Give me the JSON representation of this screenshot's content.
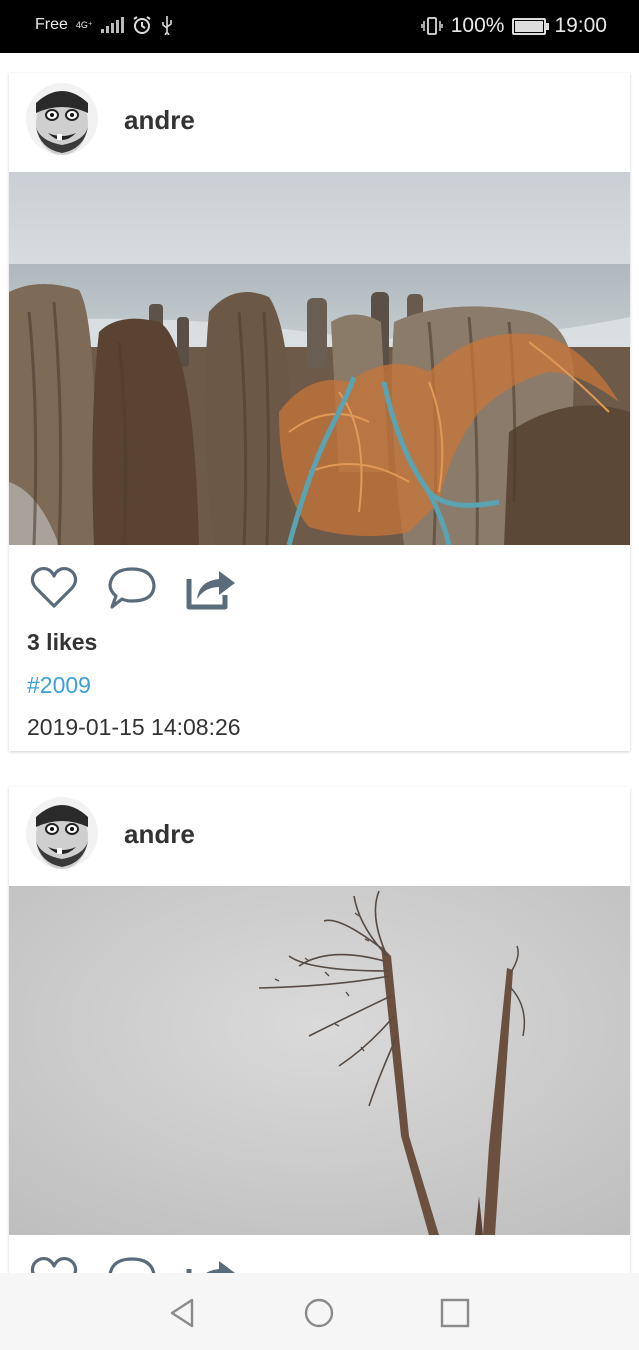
{
  "status_bar": {
    "carrier": "Free",
    "network": "4G⁺",
    "battery": "100%",
    "time": "19:00",
    "icons": [
      "signal-icon",
      "alarm-icon",
      "usb-icon",
      "vibrate-icon",
      "battery-icon"
    ]
  },
  "posts": [
    {
      "username": "andre",
      "likes": "3 likes",
      "tag": "#2009",
      "timestamp": "2019-01-15 14:08:26",
      "photo": "wooden-groyne-posts-with-fishing-net"
    },
    {
      "username": "andre",
      "photo": "dry-reed-stalks-against-grey-sky"
    }
  ],
  "actions": [
    "heart-icon",
    "comment-icon",
    "share-icon"
  ],
  "navbar": [
    "back-icon",
    "home-icon",
    "recents-icon"
  ],
  "colors": {
    "status_bar_bg": "#000000",
    "tag": "#3aa0d8",
    "icon": "#5a6b7b",
    "nav_bar_bg": "#f6f6f6"
  }
}
